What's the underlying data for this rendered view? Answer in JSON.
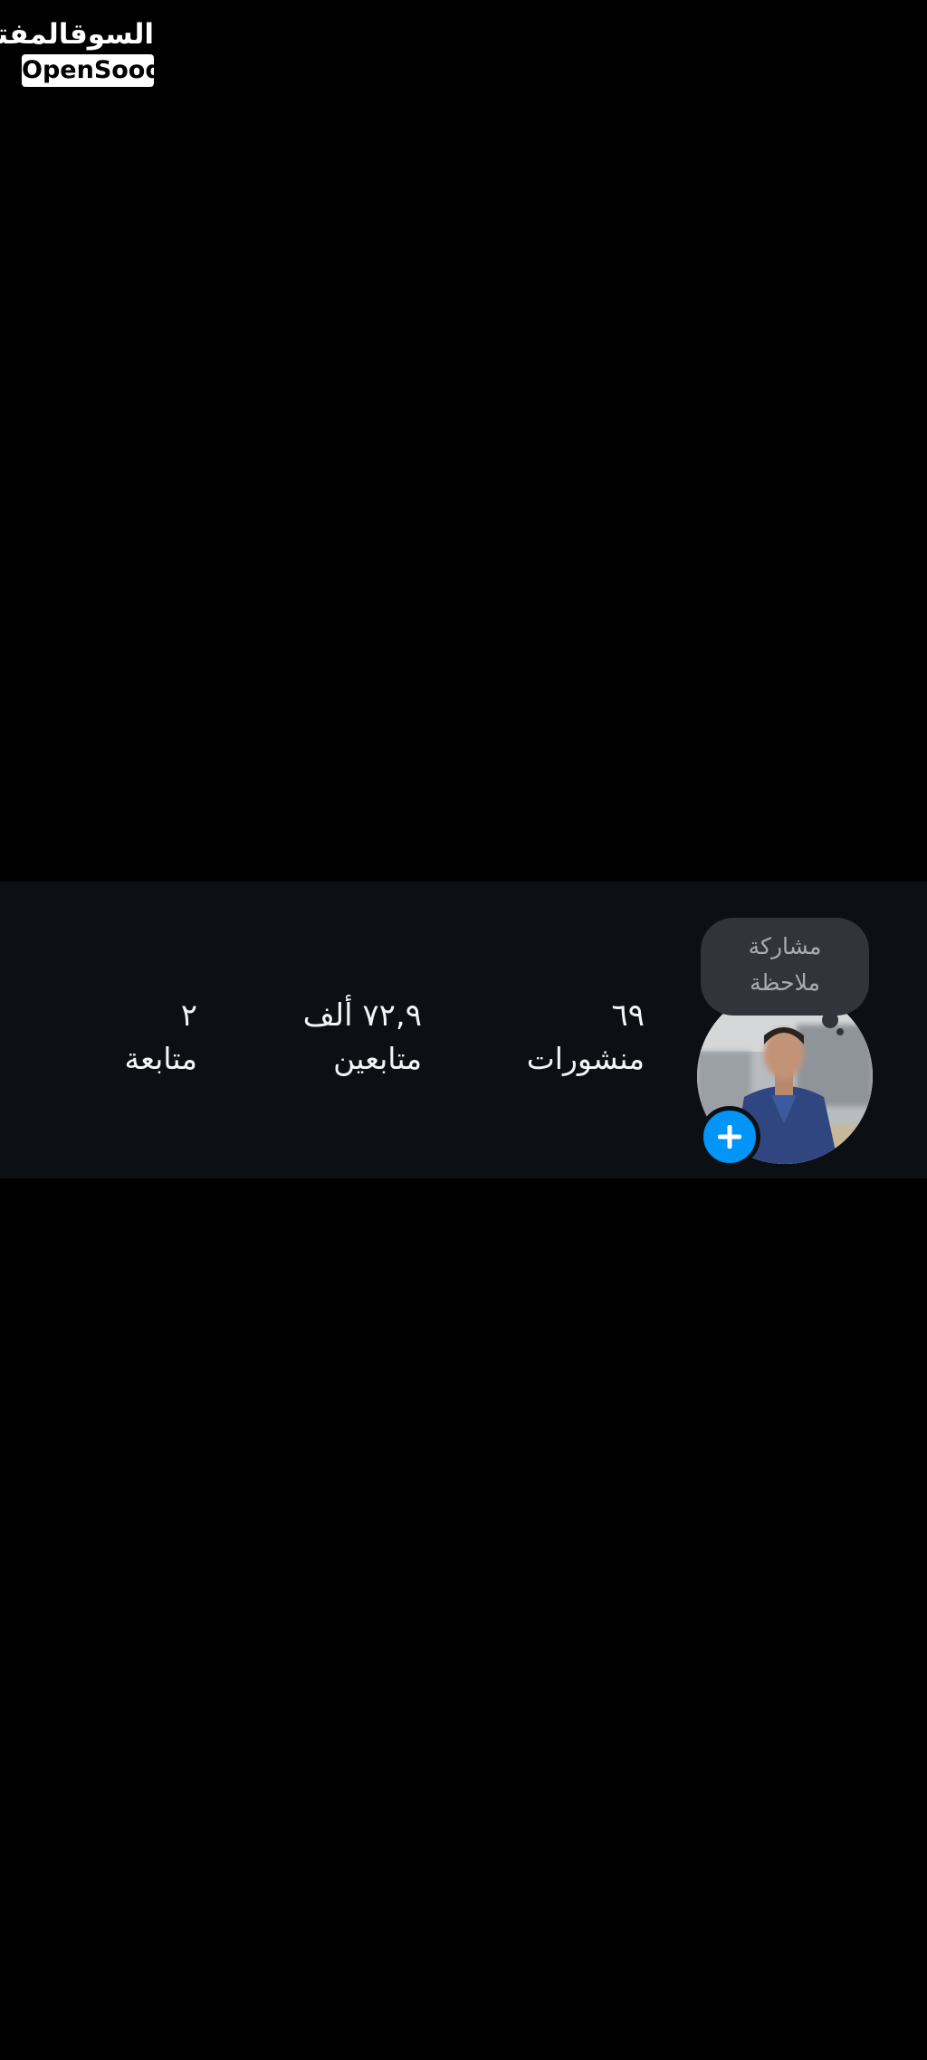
{
  "watermark": {
    "arabic": "السوقالمفتوح",
    "latin": "OpenSooq"
  },
  "note": {
    "line1": "مشاركة",
    "line2": "ملاحظة"
  },
  "stats": {
    "posts": {
      "value": "٦٩",
      "label": "منشورات"
    },
    "followers": {
      "value": "٧٢,٩ ألف",
      "label": "متابعين"
    },
    "following": {
      "value": "٢",
      "label": "متابعة"
    }
  },
  "icons": {
    "add_story": "plus-icon"
  },
  "colors": {
    "page_background": "#000000",
    "profile_background": "#0c1014",
    "note_bubble": "#31353b",
    "accent_blue": "#0095f6",
    "text_primary": "#f2f4f6",
    "text_muted": "#a8abb0"
  }
}
